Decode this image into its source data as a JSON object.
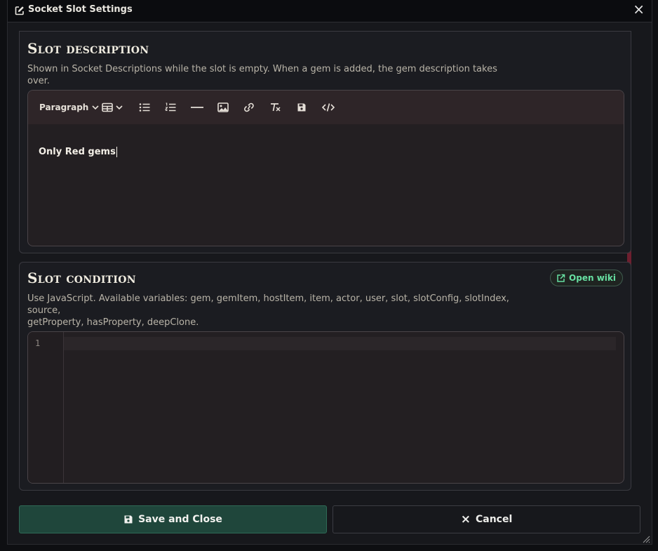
{
  "window": {
    "title": "Socket Slot Settings",
    "close_glyph": "×",
    "title_icon": "edit-icon"
  },
  "description_section": {
    "title": "Slot description",
    "help": "Shown in Socket Descriptions while the slot is empty. When a gem is added, the gem description takes over.",
    "toolbar": {
      "format_label": "Paragraph",
      "tools": [
        "table-icon",
        "bullet-list-icon",
        "numbered-list-icon",
        "horizontal-rule-icon",
        "image-icon",
        "link-icon",
        "clear-format-icon",
        "save-icon",
        "code-icon"
      ]
    },
    "content": "Only Red gems"
  },
  "condition_section": {
    "title": "Slot condition",
    "help_line1": "Use JavaScript. Available variables: gem, gemItem, hostItem, item, actor, user, slot, slotConfig, slotIndex, source,",
    "help_line2": "getProperty, hasProperty, deepClone.",
    "wiki_label": "Open wiki",
    "code_lines": [
      ""
    ],
    "line_number": "1"
  },
  "footer": {
    "save_label": "Save and Close",
    "cancel_label": "Cancel"
  },
  "colors": {
    "accent_green": "#67e0a2",
    "scrollbar_thumb": "#6e1f2f",
    "save_button_bg": "#1f463b"
  }
}
